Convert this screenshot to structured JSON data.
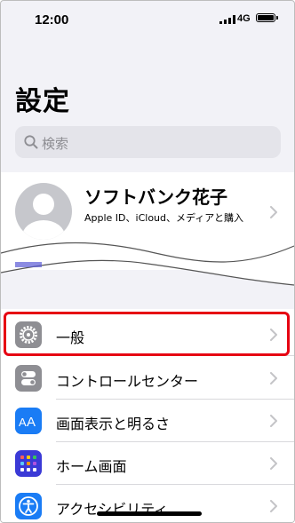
{
  "status_bar": {
    "time": "12:00",
    "network": "4G"
  },
  "page": {
    "title": "設定"
  },
  "search": {
    "placeholder": "検索"
  },
  "profile": {
    "name": "ソフトバンク花子",
    "subtitle": "Apple ID、iCloud、メディアと購入"
  },
  "settings": {
    "rows": [
      {
        "label": "一般",
        "icon": "gear-icon",
        "icon_color": "#8e8e93"
      },
      {
        "label": "コントロールセンター",
        "icon": "toggles-icon",
        "icon_color": "#8e8e93"
      },
      {
        "label": "画面表示と明るさ",
        "icon": "text-size-icon",
        "icon_color": "#1a7cf5"
      },
      {
        "label": "ホーム画面",
        "icon": "app-grid-icon",
        "icon_color": "#3b3ad6"
      },
      {
        "label": "アクセシビリティ",
        "icon": "accessibility-icon",
        "icon_color": "#1a7cf5"
      }
    ]
  },
  "highlight_color": "#e60012"
}
